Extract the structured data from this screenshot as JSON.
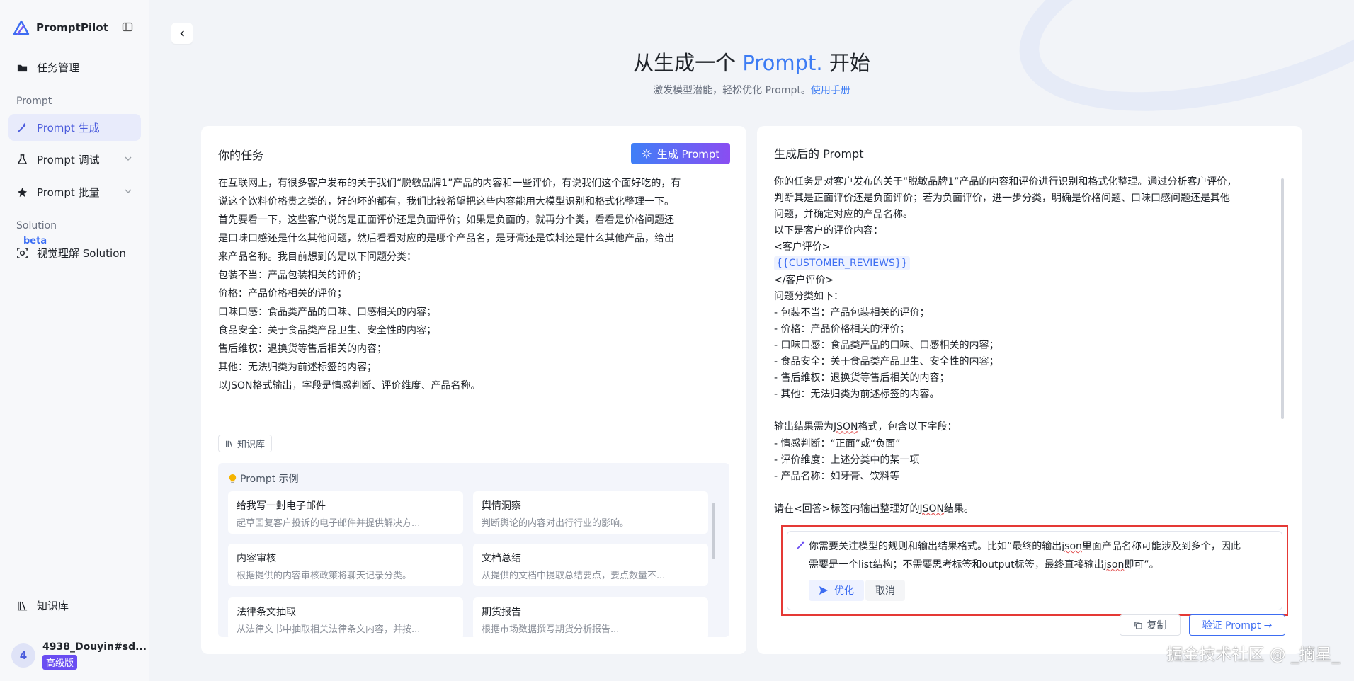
{
  "app": {
    "name": "PromptPilot"
  },
  "sidebar": {
    "task_mgmt": "任务管理",
    "section_prompt": "Prompt",
    "prompt_generate": "Prompt 生成",
    "prompt_debug": "Prompt 调试",
    "prompt_batch": "Prompt 批量",
    "section_solution": "Solution",
    "beta": "beta",
    "visual_solution": "视觉理解 Solution",
    "knowledge_base": "知识库"
  },
  "user": {
    "initial": "4",
    "name": "4938_Douyin#sd...",
    "tier": "高级版"
  },
  "hero": {
    "title_prefix": "从生成一个 ",
    "title_accent": "Prompt.",
    "title_suffix": " 开始",
    "subtitle": "激发模型潜能，轻松优化 Prompt。",
    "manual_link": "使用手册"
  },
  "left_panel": {
    "title": "你的任务",
    "generate_button": "生成 Prompt",
    "task_lines": [
      "在互联网上，有很多客户发布的关于我们“脱敏品牌1”产品的内容和一些评价，有说我们这个面好吃的，有",
      "说这个饮料价格贵之类的，好的坏的都有，我们比较希望把这些内容能用大模型识别和格式化整理一下。",
      "首先要看一下，这些客户说的是正面评价还是负面评价；如果是负面的，就再分个类，看看是价格问题还",
      "是口味口感还是什么其他问题，然后看看对应的是哪个产品名，是牙膏还是饮料还是什么其他产品，给出",
      "来产品名称。我目前想到的是以下问题分类：",
      "包装不当：产品包装相关的评价；",
      "价格：产品价格相关的评价；",
      "口味口感：食品类产品的口味、口感相关的内容；",
      "食品安全：关于食品类产品卫生、安全性的内容；",
      "售后维权：退换货等售后相关的内容；",
      "其他：无法归类为前述标签的内容；",
      "以JSON格式输出，字段是情感判断、评价维度、产品名称。"
    ],
    "kb_tag": "知识库",
    "examples_title": "Prompt 示例",
    "examples": [
      {
        "title": "给我写一封电子邮件",
        "desc": "起草回复客户投诉的电子邮件并提供解决方..."
      },
      {
        "title": "舆情洞察",
        "desc": "判断舆论的内容对出行行业的影响。"
      },
      {
        "title": "内容审核",
        "desc": "根据提供的内容审核政策将聊天记录分类。"
      },
      {
        "title": "文档总结",
        "desc": "从提供的文档中提取总结要点，要点数量不..."
      },
      {
        "title": "法律条文抽取",
        "desc": "从法律文书中抽取相关法律条文内容，并按..."
      },
      {
        "title": "期货报告",
        "desc": "根据市场数据撰写期货分析报告..."
      }
    ]
  },
  "right_panel": {
    "title": "生成后的 Prompt",
    "result": {
      "l1": "你的任务是对客户发布的关于“脱敏品牌1”产品的内容和评价进行识别和格式化整理。通过分析客户评价，",
      "l2": "判断其是正面评价还是负面评价；若为负面评价，进一步分类，明确是价格问题、口味口感问题还是其他",
      "l3": "问题，并确定对应的产品名称。",
      "l4": "以下是客户的评价内容：",
      "l5": "<客户评价>",
      "l6": "{{CUSTOMER_REVIEWS}}",
      "l7": "</客户评价>",
      "l8": "问题分类如下：",
      "l9": "- 包装不当：产品包装相关的评价；",
      "l10": "- 价格：产品价格相关的评价；",
      "l11": "- 口味口感：食品类产品的口味、口感相关的内容；",
      "l12": "- 食品安全：关于食品类产品卫生、安全性的内容；",
      "l13": "- 售后维权：退换货等售后相关的内容；",
      "l14": "- 其他：无法归类为前述标签的内容。",
      "l16a": "输出结果需为",
      "l16b": "JSON",
      "l16c": "格式，包含以下字段：",
      "l17": "- 情感判断：“正面”或“负面”",
      "l18": "- 评价维度：上述分类中的某一项",
      "l19": "- 产品名称：如牙膏、饮料等",
      "l21a": "请在<回答>标签内输出整理好的",
      "l21b": "JSON",
      "l21c": "结果。"
    },
    "optimize": {
      "line1a": "你需要关注模型的规则和输出结果格式。比如“最终的输出",
      "line1b": "json",
      "line1c": "里面产品名称可能涉及到多个，因此",
      "line2a": "需要是一个",
      "line2b": "list",
      "line2c": "结构；不需要思考标签和output标签，最终直接输出",
      "line2d": "json",
      "line2e": "即可”。",
      "optimize_button": "优化",
      "cancel_button": "取消"
    },
    "copy_button": "复制",
    "verify_button": "验证 Prompt →"
  },
  "watermark": "掘金技术社区 @ _摘星_",
  "colors": {
    "accent": "#3d7cf4",
    "active_nav": "#4a5bdc",
    "highlight_border": "#e53935",
    "badge": "#6a4df2"
  }
}
